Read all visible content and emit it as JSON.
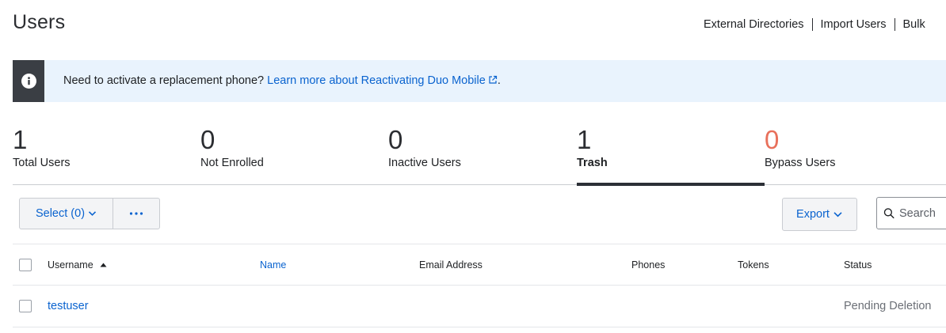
{
  "header": {
    "title": "Users",
    "links": [
      "External Directories",
      "Import Users",
      "Bulk"
    ]
  },
  "alert": {
    "icon": "info-icon",
    "text": "Need to activate a replacement phone? ",
    "link_text": "Learn more about Reactivating Duo Mobile",
    "suffix": "."
  },
  "stats": [
    {
      "value": "1",
      "label": "Total Users"
    },
    {
      "value": "0",
      "label": "Not Enrolled"
    },
    {
      "value": "0",
      "label": "Inactive Users"
    },
    {
      "value": "1",
      "label": "Trash"
    },
    {
      "value": "0",
      "label": "Bypass Users"
    }
  ],
  "active_stat": "Trash",
  "toolbar": {
    "select_label": "Select (0)",
    "more_label": "...",
    "export_label": "Export",
    "search_placeholder": "Search"
  },
  "table": {
    "columns": [
      "Username",
      "Name",
      "Email Address",
      "Phones",
      "Tokens",
      "Status"
    ],
    "sort_column": "Username",
    "rows": [
      {
        "username": "testuser",
        "name": "",
        "email": "",
        "phones": "",
        "tokens": "",
        "status": "Pending Deletion"
      }
    ]
  },
  "colors": {
    "accent": "#0a63cf",
    "danger": "#e8705b",
    "alert_bg": "#e9f3fd",
    "alert_icon_bg": "#3a3e44"
  }
}
